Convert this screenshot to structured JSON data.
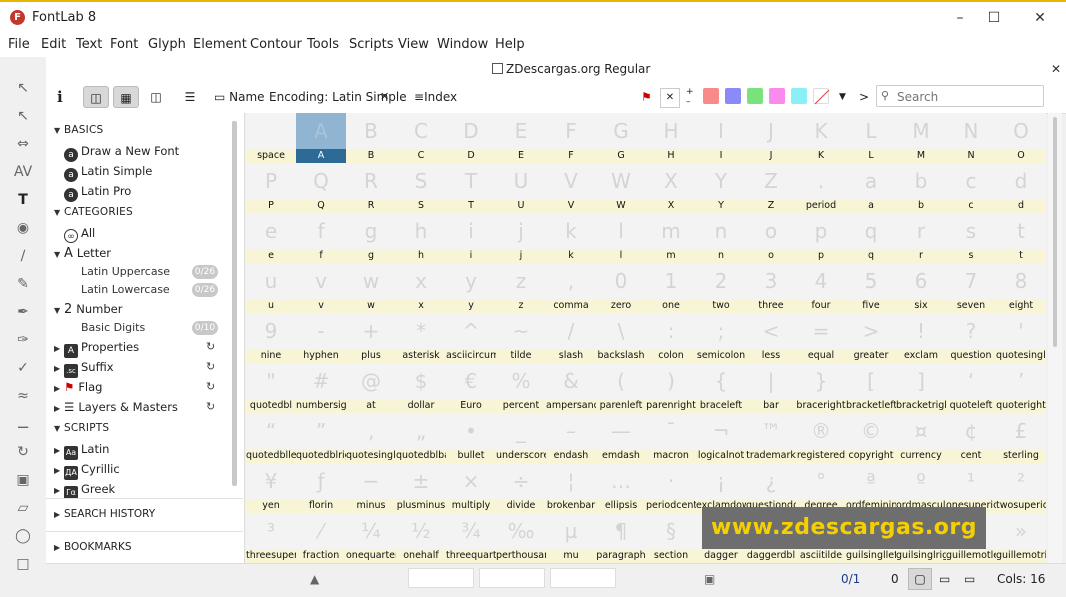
{
  "window": {
    "title": "FontLab 8",
    "logo": "F"
  },
  "menu": [
    "File",
    "Edit",
    "Text",
    "Font",
    "Glyph",
    "Element",
    "Contour",
    "Tools",
    "Scripts",
    "View",
    "Window",
    "Help"
  ],
  "font_title": "ZDescargas.org Regular",
  "toolbar": {
    "name_label": "Name",
    "encoding_label": "Encoding: Latin Simple",
    "index_label": "Index",
    "info_glyph": "i",
    "chevron_glyph": ">",
    "search_placeholder": "Search",
    "swatch_colors": [
      "#f88a8a",
      "#8a8af8",
      "#7ae27a",
      "#f88af0",
      "#8af0f8"
    ]
  },
  "sidebar": {
    "basics_header": "BASICS",
    "basics_items": [
      "Draw a New Font",
      "Latin Simple",
      "Latin Pro"
    ],
    "categories_header": "CATEGORIES",
    "cat_all": "All",
    "cat_letter": "Letter",
    "cat_letter_children": [
      {
        "label": "Latin Uppercase",
        "badge": "0/26"
      },
      {
        "label": "Latin Lowercase",
        "badge": "0/26"
      }
    ],
    "cat_number": "Number",
    "cat_number_children": [
      {
        "label": "Basic Digits",
        "badge": "0/10"
      }
    ],
    "cat_properties": "Properties",
    "cat_suffix": "Suffix",
    "cat_flag": "Flag",
    "cat_layers": "Layers & Masters",
    "scripts_header": "SCRIPTS",
    "scripts": [
      {
        "icon": "Aa",
        "label": "Latin"
      },
      {
        "icon": "ДА",
        "label": "Cyrillic"
      },
      {
        "icon": "Γα",
        "label": "Greek"
      }
    ],
    "search_history": "SEARCH HISTORY",
    "bookmarks": "BOOKMARKS"
  },
  "glyph_grid": {
    "columns": 16,
    "selected": "A",
    "cells": [
      {
        "g": "",
        "n": "space"
      },
      {
        "g": "A",
        "n": "A"
      },
      {
        "g": "B",
        "n": "B"
      },
      {
        "g": "C",
        "n": "C"
      },
      {
        "g": "D",
        "n": "D"
      },
      {
        "g": "E",
        "n": "E"
      },
      {
        "g": "F",
        "n": "F"
      },
      {
        "g": "G",
        "n": "G"
      },
      {
        "g": "H",
        "n": "H"
      },
      {
        "g": "I",
        "n": "I"
      },
      {
        "g": "J",
        "n": "J"
      },
      {
        "g": "K",
        "n": "K"
      },
      {
        "g": "L",
        "n": "L"
      },
      {
        "g": "M",
        "n": "M"
      },
      {
        "g": "N",
        "n": "N"
      },
      {
        "g": "O",
        "n": "O"
      },
      {
        "g": "P",
        "n": "P"
      },
      {
        "g": "Q",
        "n": "Q"
      },
      {
        "g": "R",
        "n": "R"
      },
      {
        "g": "S",
        "n": "S"
      },
      {
        "g": "T",
        "n": "T"
      },
      {
        "g": "U",
        "n": "U"
      },
      {
        "g": "V",
        "n": "V"
      },
      {
        "g": "W",
        "n": "W"
      },
      {
        "g": "X",
        "n": "X"
      },
      {
        "g": "Y",
        "n": "Y"
      },
      {
        "g": "Z",
        "n": "Z"
      },
      {
        "g": ".",
        "n": "period"
      },
      {
        "g": "a",
        "n": "a"
      },
      {
        "g": "b",
        "n": "b"
      },
      {
        "g": "c",
        "n": "c"
      },
      {
        "g": "d",
        "n": "d"
      },
      {
        "g": "e",
        "n": "e"
      },
      {
        "g": "f",
        "n": "f"
      },
      {
        "g": "g",
        "n": "g"
      },
      {
        "g": "h",
        "n": "h"
      },
      {
        "g": "i",
        "n": "i"
      },
      {
        "g": "j",
        "n": "j"
      },
      {
        "g": "k",
        "n": "k"
      },
      {
        "g": "l",
        "n": "l"
      },
      {
        "g": "m",
        "n": "m"
      },
      {
        "g": "n",
        "n": "n"
      },
      {
        "g": "o",
        "n": "o"
      },
      {
        "g": "p",
        "n": "p"
      },
      {
        "g": "q",
        "n": "q"
      },
      {
        "g": "r",
        "n": "r"
      },
      {
        "g": "s",
        "n": "s"
      },
      {
        "g": "t",
        "n": "t"
      },
      {
        "g": "u",
        "n": "u"
      },
      {
        "g": "v",
        "n": "v"
      },
      {
        "g": "w",
        "n": "w"
      },
      {
        "g": "x",
        "n": "x"
      },
      {
        "g": "y",
        "n": "y"
      },
      {
        "g": "z",
        "n": "z"
      },
      {
        "g": ",",
        "n": "comma"
      },
      {
        "g": "0",
        "n": "zero"
      },
      {
        "g": "1",
        "n": "one"
      },
      {
        "g": "2",
        "n": "two"
      },
      {
        "g": "3",
        "n": "three"
      },
      {
        "g": "4",
        "n": "four"
      },
      {
        "g": "5",
        "n": "five"
      },
      {
        "g": "6",
        "n": "six"
      },
      {
        "g": "7",
        "n": "seven"
      },
      {
        "g": "8",
        "n": "eight"
      },
      {
        "g": "9",
        "n": "nine"
      },
      {
        "g": "-",
        "n": "hyphen"
      },
      {
        "g": "+",
        "n": "plus"
      },
      {
        "g": "*",
        "n": "asterisk"
      },
      {
        "g": "^",
        "n": "asciicircum"
      },
      {
        "g": "~",
        "n": "tilde"
      },
      {
        "g": "/",
        "n": "slash"
      },
      {
        "g": "\\",
        "n": "backslash"
      },
      {
        "g": ":",
        "n": "colon"
      },
      {
        "g": ";",
        "n": "semicolon"
      },
      {
        "g": "<",
        "n": "less"
      },
      {
        "g": "=",
        "n": "equal"
      },
      {
        "g": ">",
        "n": "greater"
      },
      {
        "g": "!",
        "n": "exclam"
      },
      {
        "g": "?",
        "n": "question"
      },
      {
        "g": "'",
        "n": "quotesingle"
      },
      {
        "g": "\"",
        "n": "quotedbl"
      },
      {
        "g": "#",
        "n": "numbersign"
      },
      {
        "g": "@",
        "n": "at"
      },
      {
        "g": "$",
        "n": "dollar"
      },
      {
        "g": "€",
        "n": "Euro"
      },
      {
        "g": "%",
        "n": "percent"
      },
      {
        "g": "&",
        "n": "ampersand"
      },
      {
        "g": "(",
        "n": "parenleft"
      },
      {
        "g": ")",
        "n": "parenright"
      },
      {
        "g": "{",
        "n": "braceleft"
      },
      {
        "g": "|",
        "n": "bar"
      },
      {
        "g": "}",
        "n": "braceright"
      },
      {
        "g": "[",
        "n": "bracketleft"
      },
      {
        "g": "]",
        "n": "bracketright"
      },
      {
        "g": "‘",
        "n": "quoteleft"
      },
      {
        "g": "’",
        "n": "quoteright"
      },
      {
        "g": "“",
        "n": "quotedblleft"
      },
      {
        "g": "”",
        "n": "quotedblright"
      },
      {
        "g": "‚",
        "n": "quotesinglbase"
      },
      {
        "g": "„",
        "n": "quotedblbase"
      },
      {
        "g": "•",
        "n": "bullet"
      },
      {
        "g": "_",
        "n": "underscore"
      },
      {
        "g": "–",
        "n": "endash"
      },
      {
        "g": "—",
        "n": "emdash"
      },
      {
        "g": "¯",
        "n": "macron"
      },
      {
        "g": "¬",
        "n": "logicalnot"
      },
      {
        "g": "™",
        "n": "trademark"
      },
      {
        "g": "®",
        "n": "registered"
      },
      {
        "g": "©",
        "n": "copyright"
      },
      {
        "g": "¤",
        "n": "currency"
      },
      {
        "g": "¢",
        "n": "cent"
      },
      {
        "g": "£",
        "n": "sterling"
      },
      {
        "g": "¥",
        "n": "yen"
      },
      {
        "g": "ƒ",
        "n": "florin"
      },
      {
        "g": "−",
        "n": "minus"
      },
      {
        "g": "±",
        "n": "plusminus"
      },
      {
        "g": "×",
        "n": "multiply"
      },
      {
        "g": "÷",
        "n": "divide"
      },
      {
        "g": "¦",
        "n": "brokenbar"
      },
      {
        "g": "…",
        "n": "ellipsis"
      },
      {
        "g": "·",
        "n": "periodcentered"
      },
      {
        "g": "¡",
        "n": "exclamdown"
      },
      {
        "g": "¿",
        "n": "questiondown"
      },
      {
        "g": "°",
        "n": "degree"
      },
      {
        "g": "ª",
        "n": "ordfeminine"
      },
      {
        "g": "º",
        "n": "ordmasculine"
      },
      {
        "g": "¹",
        "n": "onesuperior"
      },
      {
        "g": "²",
        "n": "twosuperior"
      },
      {
        "g": "³",
        "n": "threesuperior"
      },
      {
        "g": "⁄",
        "n": "fraction"
      },
      {
        "g": "¼",
        "n": "onequarter"
      },
      {
        "g": "½",
        "n": "onehalf"
      },
      {
        "g": "¾",
        "n": "threequarters"
      },
      {
        "g": "‰",
        "n": "perthousand"
      },
      {
        "g": "µ",
        "n": "mu"
      },
      {
        "g": "¶",
        "n": "paragraph"
      },
      {
        "g": "§",
        "n": "section"
      },
      {
        "g": "†",
        "n": "dagger"
      },
      {
        "g": "‡",
        "n": "daggerdbl"
      },
      {
        "g": "~",
        "n": "asciitilde"
      },
      {
        "g": "‹",
        "n": "guilsinglleft"
      },
      {
        "g": "›",
        "n": "guilsinglright"
      },
      {
        "g": "«",
        "n": "guillemotleft"
      },
      {
        "g": "»",
        "n": "guillemotright"
      }
    ]
  },
  "watermark": "www.zdescargas.org",
  "status": {
    "count": "0/1",
    "zero": "0",
    "cols": "Cols: 16"
  }
}
